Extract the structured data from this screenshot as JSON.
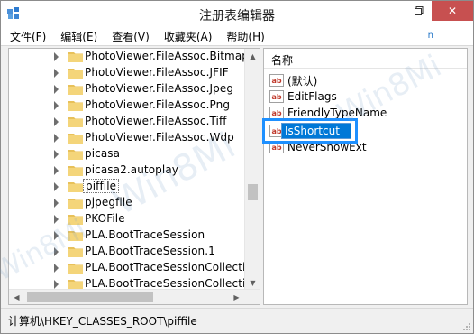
{
  "window": {
    "title": "注册表编辑器"
  },
  "menu": {
    "items": [
      "文件(F)",
      "编辑(E)",
      "查看(V)",
      "收藏夹(A)",
      "帮助(H)"
    ]
  },
  "ghost_letter": "n",
  "tree": {
    "items": [
      {
        "label": "PhotoViewer.FileAssoc.Bitmap"
      },
      {
        "label": "PhotoViewer.FileAssoc.JFIF"
      },
      {
        "label": "PhotoViewer.FileAssoc.Jpeg"
      },
      {
        "label": "PhotoViewer.FileAssoc.Png"
      },
      {
        "label": "PhotoViewer.FileAssoc.Tiff"
      },
      {
        "label": "PhotoViewer.FileAssoc.Wdp"
      },
      {
        "label": "picasa"
      },
      {
        "label": "picasa2.autoplay"
      },
      {
        "label": "piffile",
        "selected": true
      },
      {
        "label": "pjpegfile"
      },
      {
        "label": "PKOFile"
      },
      {
        "label": "PLA.BootTraceSession"
      },
      {
        "label": "PLA.BootTraceSession.1"
      },
      {
        "label": "PLA.BootTraceSessionCollectio"
      },
      {
        "label": "PLA.BootTraceSessionCollectio"
      }
    ]
  },
  "values": {
    "column_name": "名称",
    "items": [
      {
        "icon": "ab",
        "name": "(默认)"
      },
      {
        "icon": "ab",
        "name": "EditFlags"
      },
      {
        "icon": "ab",
        "name": "FriendlyTypeName"
      },
      {
        "icon": "ab",
        "name": "IsShortcut",
        "editing": true
      },
      {
        "icon": "ab",
        "name": "NeverShowExt"
      }
    ]
  },
  "status": {
    "path": "计算机\\HKEY_CLASSES_ROOT\\piffile"
  },
  "watermark": {
    "text": "Win8Mi",
    "color": "#78a0c8"
  },
  "colors": {
    "accent": "#1e90ff",
    "selection": "#0078d7",
    "close": "#c75050"
  }
}
